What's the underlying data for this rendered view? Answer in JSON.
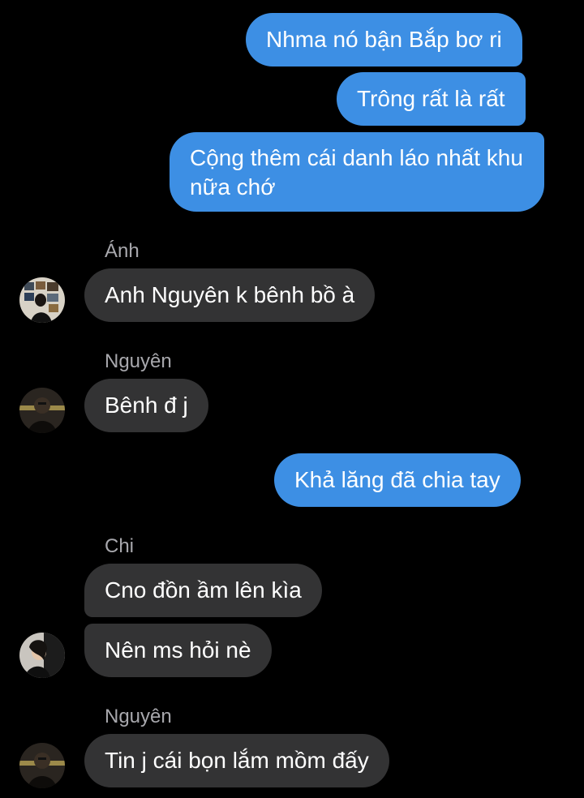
{
  "messages": [
    {
      "direction": "outgoing",
      "text": "Nhma nó bận Bắp bơ ri"
    },
    {
      "direction": "outgoing",
      "text": "Trông rất là rất"
    },
    {
      "direction": "outgoing",
      "text": "Cộng thêm cái danh láo nhất khu nữa chớ"
    },
    {
      "direction": "incoming",
      "sender": "Ánh",
      "text": "Anh Nguyên k bênh bồ à"
    },
    {
      "direction": "incoming",
      "sender": "Nguyên",
      "text": "Bênh đ j"
    },
    {
      "direction": "outgoing",
      "text": "Khả lăng đã chia tay"
    },
    {
      "direction": "incoming",
      "sender": "Chi",
      "text": "Cno đồn ầm lên kìa"
    },
    {
      "direction": "incoming",
      "text": "Nên ms hỏi nè"
    },
    {
      "direction": "incoming",
      "sender": "Nguyên",
      "text": "Tin j cái bọn lắm mồm đấy"
    }
  ],
  "colors": {
    "background": "#000000",
    "outgoing_bubble": "#3d8fe4",
    "incoming_bubble": "#333334",
    "sender_name": "#a8a8ad",
    "text": "#ffffff"
  },
  "avatars": [
    "avatar-anh",
    "avatar-nguyen",
    "avatar-chi",
    "avatar-nguyen"
  ]
}
